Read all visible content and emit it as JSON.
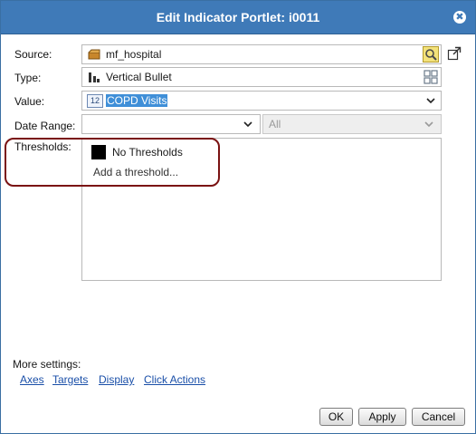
{
  "dialog": {
    "title": "Edit Indicator Portlet: i0011",
    "close_symbol": "✖"
  },
  "form": {
    "source": {
      "label": "Source:",
      "value": "mf_hospital",
      "icon": "cube-icon",
      "action_icon": "search-icon",
      "open_icon": "external-link-icon"
    },
    "type": {
      "label": "Type:",
      "value": "Vertical Bullet",
      "icon": "bar-chart-icon",
      "action_icon": "grid-icon"
    },
    "value": {
      "label": "Value:",
      "value": "COPD Visits",
      "icon_text": "12"
    },
    "date_range": {
      "label": "Date Range:",
      "value": "",
      "secondary": "All"
    },
    "thresholds": {
      "label": "Thresholds:",
      "items": [
        {
          "label": "No Thresholds",
          "color": "#000000"
        }
      ],
      "add_label": "Add a threshold..."
    }
  },
  "more_settings": {
    "label": "More settings:",
    "links": [
      "Axes",
      "Targets",
      "Display",
      "Click Actions"
    ]
  },
  "buttons": {
    "ok": "OK",
    "apply": "Apply",
    "cancel": "Cancel"
  },
  "colors": {
    "titlebar": "#3f7ab8",
    "link": "#1a4fa8",
    "annotation": "#7a1212",
    "selection": "#3f8fd8"
  }
}
